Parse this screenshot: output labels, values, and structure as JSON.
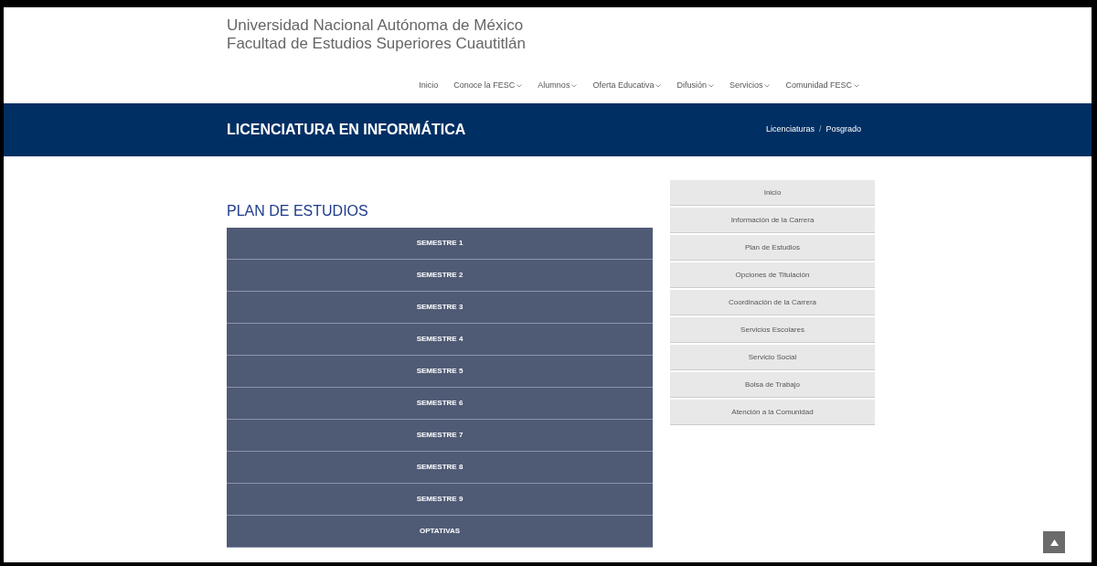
{
  "header": {
    "title_lines": [
      "Universidad Nacional Autónoma de México",
      "Facultad de Estudios Superiores Cuautitlán"
    ]
  },
  "nav": [
    {
      "label": "Inicio",
      "dropdown": false
    },
    {
      "label": "Conoce la FESC",
      "dropdown": true
    },
    {
      "label": "Alumnos",
      "dropdown": true
    },
    {
      "label": "Oferta Educativa",
      "dropdown": true
    },
    {
      "label": "Difusión",
      "dropdown": true
    },
    {
      "label": "Servicios",
      "dropdown": true
    },
    {
      "label": "Comunidad FESC",
      "dropdown": true
    }
  ],
  "banner": {
    "title": "LICENCIATURA EN INFORMÁTICA",
    "breadcrumb": [
      "Licenciaturas",
      "Posgrado"
    ],
    "separator": "/"
  },
  "section_title": "PLAN DE ESTUDIOS",
  "accordion": [
    {
      "label": "SEMESTRE 1",
      "expanded": false
    },
    {
      "label": "SEMESTRE 2",
      "expanded": false
    },
    {
      "label": "SEMESTRE 3",
      "expanded": false
    },
    {
      "label": "SEMESTRE 4",
      "expanded": false
    },
    {
      "label": "SEMESTRE 5",
      "expanded": false
    },
    {
      "label": "SEMESTRE 6",
      "expanded": false
    },
    {
      "label": "SEMESTRE 7",
      "expanded": false
    },
    {
      "label": "SEMESTRE 8",
      "expanded": false
    },
    {
      "label": "SEMESTRE 9",
      "expanded": false
    },
    {
      "label": "OPTATIVAS",
      "expanded": false
    }
  ],
  "sidebar": {
    "items": [
      "Inicio",
      "Información de la Carrera",
      "Plan de Estudios",
      "Opciones de Titulación",
      "Coordinación de la Carrera",
      "Servicios Escolares",
      "Servicio Social",
      "Bolsa de Trabajo",
      "Atención a la Comunidad"
    ]
  }
}
